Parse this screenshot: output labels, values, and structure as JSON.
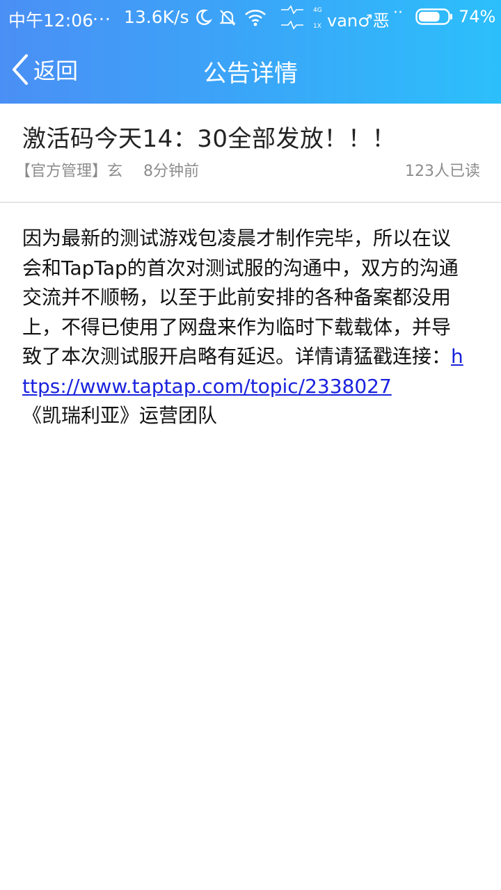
{
  "status_bar": {
    "time": "中午12:06",
    "dots": "...",
    "net_speed": "13.6K/s",
    "signal_top": "4G",
    "signal_bottom": "1X",
    "carrier": "van♂恶",
    "carrier_dots": "··",
    "battery_percent": "74%",
    "battery_level": 0.74
  },
  "nav": {
    "back_label": "返回",
    "title": "公告详情"
  },
  "post": {
    "title": "激活码今天14：30全部发放！！！",
    "author": "【官方管理】玄",
    "time": "8分钟前",
    "reads": "123人已读",
    "body_text": "因为最新的测试游戏包凌晨才制作完毕，所以在议会和TapTap的首次对测试服的沟通中，双方的沟通交流并不顺畅，以至于此前安排的各种备案都没用上，不得已使用了网盘来作为临时下载载体，并导致了本次测试服开启略有延迟。详情请猛戳连接：",
    "link": "https://www.taptap.com/topic/2338027",
    "signature": "《凯瑞利亚》运营团队"
  },
  "colors": {
    "header_start": "#4a8ff5",
    "header_end": "#2cbffb",
    "link": "#1a22dd"
  }
}
